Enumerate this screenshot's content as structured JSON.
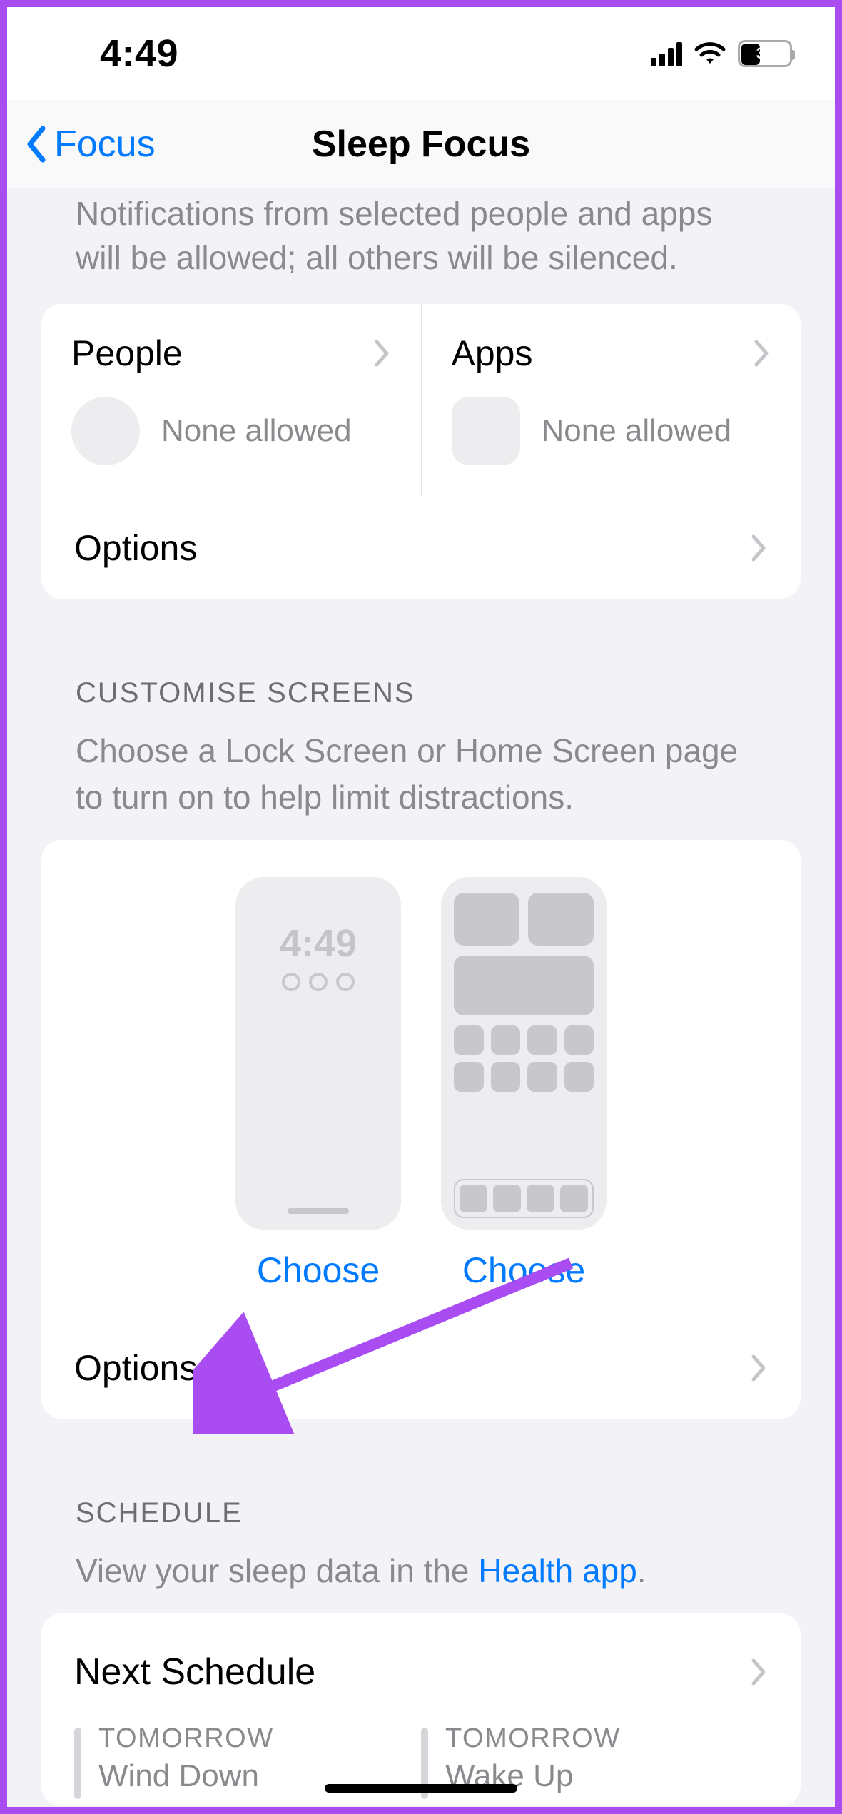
{
  "statusbar": {
    "time": "4:49",
    "battery_pct": "36"
  },
  "nav": {
    "back_label": "Focus",
    "title": "Sleep Focus"
  },
  "partial_description": "Notifications from selected people and apps will be allowed; all others will be silenced.",
  "allowed": {
    "people": {
      "title": "People",
      "status": "None allowed"
    },
    "apps": {
      "title": "Apps",
      "status": "None allowed"
    },
    "options_label": "Options"
  },
  "customise": {
    "header": "CUSTOMISE SCREENS",
    "description": "Choose a Lock Screen or Home Screen page to turn on to help limit distractions.",
    "lock_time": "4:49",
    "choose_label": "Choose",
    "options_label": "Options"
  },
  "schedule": {
    "header": "SCHEDULE",
    "desc_prefix": "View your sleep data in the ",
    "desc_link": "Health app",
    "desc_suffix": ".",
    "next_label": "Next Schedule",
    "items": [
      {
        "label": "TOMORROW",
        "name": "Wind Down"
      },
      {
        "label": "TOMORROW",
        "name": "Wake Up"
      }
    ]
  },
  "annotation": {
    "arrow_color": "#A94DF3"
  }
}
